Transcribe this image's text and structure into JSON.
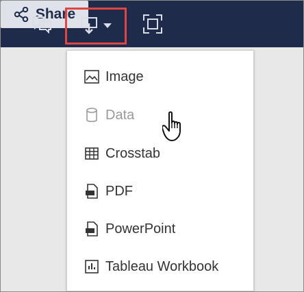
{
  "toolbar": {
    "share_label": "Share",
    "icons": [
      "comment-icon",
      "download-icon",
      "chevron-down-icon",
      "fullscreen-icon",
      "share-icon"
    ]
  },
  "menu": {
    "items": [
      {
        "label": "Image",
        "icon": "image-icon"
      },
      {
        "label": "Data",
        "icon": "database-icon",
        "state": "highlighted"
      },
      {
        "label": "Crosstab",
        "icon": "table-icon"
      },
      {
        "label": "PDF",
        "icon": "pdf-icon"
      },
      {
        "label": "PowerPoint",
        "icon": "powerpoint-icon"
      },
      {
        "label": "Tableau Workbook",
        "icon": "workbook-icon"
      }
    ]
  },
  "colors": {
    "toolbar": "#1f2b4a",
    "highlight_border": "#e0463f",
    "disabled_text": "#9a9a9a"
  }
}
